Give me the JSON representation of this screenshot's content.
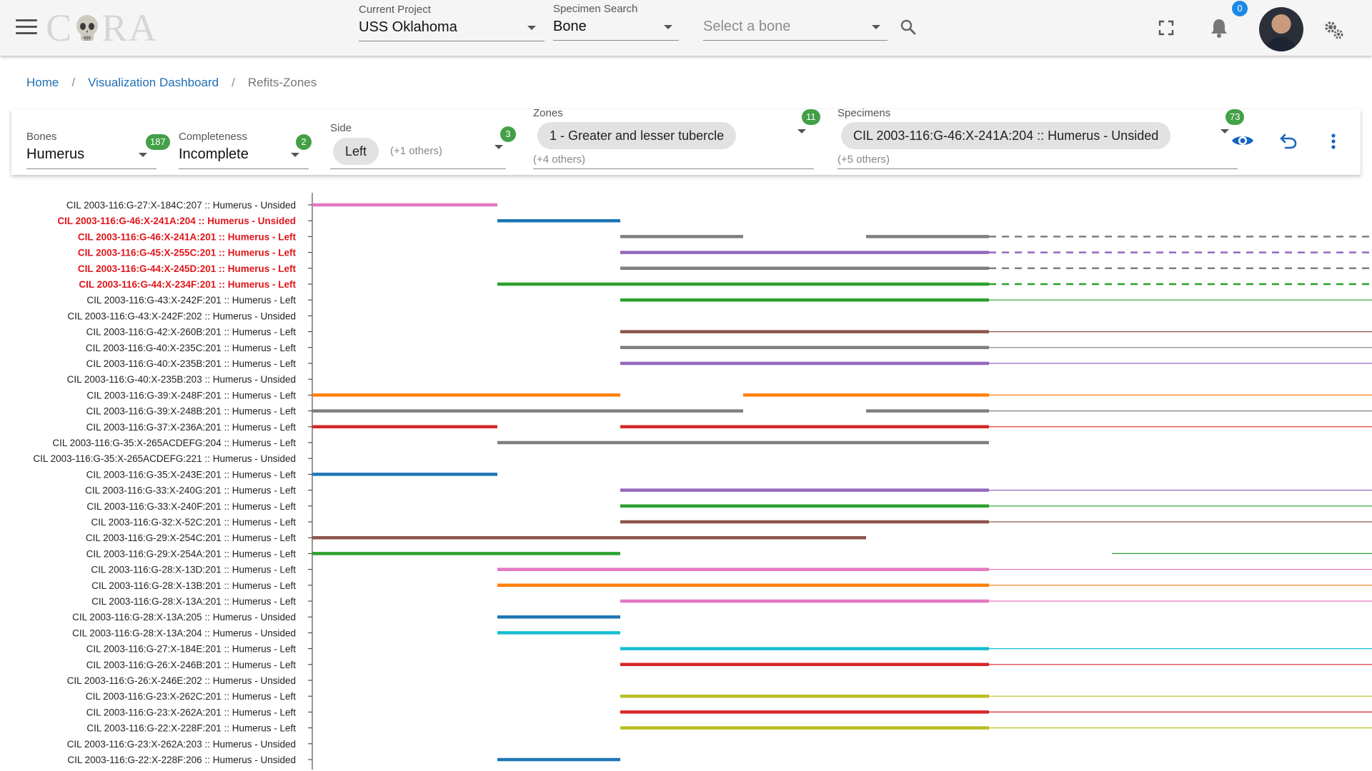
{
  "header": {
    "logo_text_left": "C",
    "logo_text_right": "RA",
    "current_project": {
      "label": "Current Project",
      "value": "USS Oklahoma"
    },
    "specimen_search": {
      "label": "Specimen Search",
      "value": "Bone"
    },
    "bone_select": {
      "placeholder": "Select a bone"
    },
    "notifications_count": "0",
    "icons": [
      "menu-icon",
      "search-icon",
      "fullscreen-icon",
      "bell-icon",
      "settings-gears-icon"
    ]
  },
  "breadcrumb": {
    "home": "Home",
    "dashboard": "Visualization Dashboard",
    "current": "Refits-Zones",
    "separator": "/"
  },
  "filters": {
    "bones": {
      "label": "Bones",
      "value": "Humerus",
      "count": "187"
    },
    "completeness": {
      "label": "Completeness",
      "value": "Incomplete",
      "count": "2"
    },
    "side": {
      "label": "Side",
      "chip": "Left",
      "others": "(+1 others)",
      "count": "3"
    },
    "zones": {
      "label": "Zones",
      "chip": "1 - Greater and lesser tubercle",
      "others": "(+4 others)",
      "count": "11"
    },
    "specimens": {
      "label": "Specimens",
      "chip": "CIL 2003-116:G-46:X-241A:204 :: Humerus - Unsided",
      "others": "(+5 others)",
      "count": "73"
    },
    "action_icons": [
      "eye-icon",
      "undo-icon",
      "more-vert-icon"
    ]
  },
  "colors": {
    "pink": "#e377c2",
    "blue": "#1f77b4",
    "gray": "#7f7f7f",
    "purple": "#9467bd",
    "green": "#2ca02c",
    "brown": "#8c564b",
    "orange": "#ff7f0e",
    "red": "#d62728",
    "cyan": "#17becf",
    "olive": "#bcbd22",
    "highlight_text": "#e0161b",
    "link": "#1f6fb5",
    "badge_green": "#43a047",
    "badge_blue": "#1e88e5"
  },
  "chart_data": {
    "type": "gantt",
    "x_breaks": [
      0,
      1,
      2,
      3,
      4,
      5
    ],
    "rows": [
      {
        "label": "CIL 2003-116:G-27:X-184C:207 :: Humerus - Unsided",
        "highlight": false,
        "color": "pink",
        "segments": [
          [
            0,
            1.5
          ]
        ]
      },
      {
        "label": "CIL 2003-116:G-46:X-241A:204 :: Humerus - Unsided",
        "highlight": true,
        "color": "blue",
        "segments": [
          [
            1.5,
            2.5
          ]
        ]
      },
      {
        "label": "CIL 2003-116:G-46:X-241A:201 :: Humerus - Left",
        "highlight": true,
        "color": "gray",
        "segments": [
          [
            2.5,
            3.5
          ],
          [
            4.5,
            5.5
          ]
        ],
        "tail": "dashed"
      },
      {
        "label": "CIL 2003-116:G-45:X-255C:201 :: Humerus - Left",
        "highlight": true,
        "color": "purple",
        "segments": [
          [
            2.5,
            5.5
          ]
        ],
        "tail": "dashed"
      },
      {
        "label": "CIL 2003-116:G-44:X-245D:201 :: Humerus - Left",
        "highlight": true,
        "color": "gray",
        "segments": [
          [
            2.5,
            5.5
          ]
        ],
        "tail": "dashed"
      },
      {
        "label": "CIL 2003-116:G-44:X-234F:201 :: Humerus - Left",
        "highlight": true,
        "color": "green",
        "segments": [
          [
            1.5,
            5.5
          ]
        ],
        "tail": "dashed"
      },
      {
        "label": "CIL 2003-116:G-43:X-242F:201 :: Humerus - Left",
        "highlight": false,
        "color": "green",
        "segments": [
          [
            2.5,
            5.5
          ]
        ],
        "tail": "thin"
      },
      {
        "label": "CIL 2003-116:G-43:X-242F:202 :: Humerus - Unsided",
        "highlight": false,
        "color": "gray",
        "segments": []
      },
      {
        "label": "CIL 2003-116:G-42:X-260B:201 :: Humerus - Left",
        "highlight": false,
        "color": "brown",
        "segments": [
          [
            2.5,
            5.5
          ]
        ],
        "tail": "thin"
      },
      {
        "label": "CIL 2003-116:G-40:X-235C:201 :: Humerus - Left",
        "highlight": false,
        "color": "gray",
        "segments": [
          [
            2.5,
            5.5
          ]
        ],
        "tail": "thin"
      },
      {
        "label": "CIL 2003-116:G-40:X-235B:201 :: Humerus - Left",
        "highlight": false,
        "color": "purple",
        "segments": [
          [
            2.5,
            5.5
          ]
        ],
        "tail": "thin"
      },
      {
        "label": "CIL 2003-116:G-40:X-235B:203 :: Humerus - Unsided",
        "highlight": false,
        "color": "gray",
        "segments": []
      },
      {
        "label": "CIL 2003-116:G-39:X-248F:201 :: Humerus - Left",
        "highlight": false,
        "color": "orange",
        "segments": [
          [
            0,
            2.5
          ],
          [
            3.5,
            5.5
          ]
        ],
        "tail": "thin"
      },
      {
        "label": "CIL 2003-116:G-39:X-248B:201 :: Humerus - Left",
        "highlight": false,
        "color": "gray",
        "segments": [
          [
            0,
            3.5
          ],
          [
            4.5,
            5.5
          ]
        ],
        "tail": "thin"
      },
      {
        "label": "CIL 2003-116:G-37:X-236A:201 :: Humerus - Left",
        "highlight": false,
        "color": "red",
        "segments": [
          [
            0,
            1.5
          ],
          [
            2.5,
            5.5
          ]
        ],
        "tail": "thin"
      },
      {
        "label": "CIL 2003-116:G-35:X-265ACDEFG:204 :: Humerus - Left",
        "highlight": false,
        "color": "gray",
        "segments": [
          [
            1.5,
            5.5
          ]
        ]
      },
      {
        "label": "CIL 2003-116:G-35:X-265ACDEFG:221 :: Humerus - Unsided",
        "highlight": false,
        "color": "gray",
        "segments": []
      },
      {
        "label": "CIL 2003-116:G-35:X-243E:201 :: Humerus - Left",
        "highlight": false,
        "color": "blue",
        "segments": [
          [
            0,
            1.5
          ]
        ]
      },
      {
        "label": "CIL 2003-116:G-33:X-240G:201 :: Humerus - Left",
        "highlight": false,
        "color": "purple",
        "segments": [
          [
            2.5,
            5.5
          ]
        ],
        "tail": "thin"
      },
      {
        "label": "CIL 2003-116:G-33:X-240F:201 :: Humerus - Left",
        "highlight": false,
        "color": "green",
        "segments": [
          [
            2.5,
            5.5
          ]
        ],
        "tail": "thin"
      },
      {
        "label": "CIL 2003-116:G-32:X-52C:201 :: Humerus - Left",
        "highlight": false,
        "color": "brown",
        "segments": [
          [
            2.5,
            5.5
          ]
        ],
        "tail": "thin"
      },
      {
        "label": "CIL 2003-116:G-29:X-254C:201 :: Humerus - Left",
        "highlight": false,
        "color": "brown",
        "segments": [
          [
            0,
            4.5
          ]
        ]
      },
      {
        "label": "CIL 2003-116:G-29:X-254A:201 :: Humerus - Left",
        "highlight": false,
        "color": "green",
        "segments": [
          [
            0,
            2.5
          ]
        ],
        "tail": "thin-late"
      },
      {
        "label": "CIL 2003-116:G-28:X-13D:201 :: Humerus - Left",
        "highlight": false,
        "color": "pink",
        "segments": [
          [
            1.5,
            5.5
          ]
        ],
        "tail": "thin"
      },
      {
        "label": "CIL 2003-116:G-28:X-13B:201 :: Humerus - Left",
        "highlight": false,
        "color": "orange",
        "segments": [
          [
            1.5,
            5.5
          ]
        ],
        "tail": "thin"
      },
      {
        "label": "CIL 2003-116:G-28:X-13A:201 :: Humerus - Left",
        "highlight": false,
        "color": "pink",
        "segments": [
          [
            2.5,
            5.5
          ]
        ],
        "tail": "thin"
      },
      {
        "label": "CIL 2003-116:G-28:X-13A:205 :: Humerus - Unsided",
        "highlight": false,
        "color": "blue",
        "segments": [
          [
            1.5,
            2.5
          ]
        ]
      },
      {
        "label": "CIL 2003-116:G-28:X-13A:204 :: Humerus - Unsided",
        "highlight": false,
        "color": "cyan",
        "segments": [
          [
            1.5,
            2.5
          ]
        ]
      },
      {
        "label": "CIL 2003-116:G-27:X-184E:201 :: Humerus - Left",
        "highlight": false,
        "color": "cyan",
        "segments": [
          [
            2.5,
            5.5
          ]
        ],
        "tail": "thin"
      },
      {
        "label": "CIL 2003-116:G-26:X-246B:201 :: Humerus - Left",
        "highlight": false,
        "color": "red",
        "segments": [
          [
            2.5,
            5.5
          ]
        ],
        "tail": "thin"
      },
      {
        "label": "CIL 2003-116:G-26:X-246E:202 :: Humerus - Unsided",
        "highlight": false,
        "color": "gray",
        "segments": []
      },
      {
        "label": "CIL 2003-116:G-23:X-262C:201 :: Humerus - Left",
        "highlight": false,
        "color": "olive",
        "segments": [
          [
            2.5,
            5.5
          ]
        ],
        "tail": "thin"
      },
      {
        "label": "CIL 2003-116:G-23:X-262A:201 :: Humerus - Left",
        "highlight": false,
        "color": "red",
        "segments": [
          [
            2.5,
            5.5
          ]
        ],
        "tail": "thin"
      },
      {
        "label": "CIL 2003-116:G-22:X-228F:201 :: Humerus - Left",
        "highlight": false,
        "color": "olive",
        "segments": [
          [
            2.5,
            5.5
          ]
        ],
        "tail": "thin"
      },
      {
        "label": "CIL 2003-116:G-23:X-262A:203 :: Humerus - Unsided",
        "highlight": false,
        "color": "gray",
        "segments": []
      },
      {
        "label": "CIL 2003-116:G-22:X-228F:206 :: Humerus - Unsided",
        "highlight": false,
        "color": "blue",
        "segments": [
          [
            1.5,
            2.5
          ]
        ]
      }
    ]
  }
}
